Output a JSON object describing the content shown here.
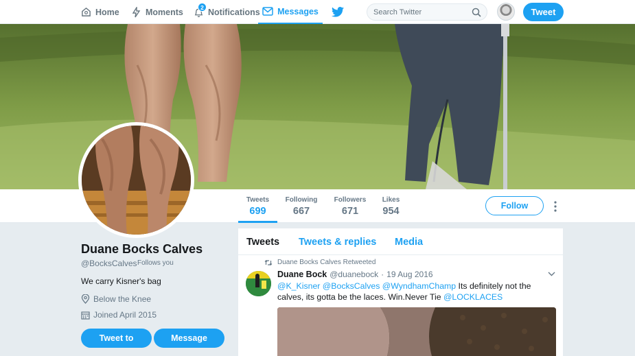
{
  "nav": {
    "home": "Home",
    "moments": "Moments",
    "notifications": "Notifications",
    "notifications_count": "2",
    "messages": "Messages",
    "search_placeholder": "Search Twitter",
    "tweet_button": "Tweet"
  },
  "stats": [
    {
      "label": "Tweets",
      "value": "699"
    },
    {
      "label": "Following",
      "value": "667"
    },
    {
      "label": "Followers",
      "value": "671"
    },
    {
      "label": "Likes",
      "value": "954"
    }
  ],
  "follow_button": "Follow",
  "profile": {
    "name": "Duane Bocks Calves",
    "handle": "@BocksCalves",
    "follows_you": "Follows you",
    "bio": "We carry Kisner's bag",
    "location": "Below the Knee",
    "joined": "Joined April 2015",
    "tweet_to": "Tweet to",
    "message": "Message"
  },
  "tabs": [
    "Tweets",
    "Tweets & replies",
    "Media"
  ],
  "tweet": {
    "retweeted_by": "Duane Bocks Calves Retweeted",
    "author_name": "Duane Bock",
    "author_handle": "@duanebock",
    "separator": "·",
    "date": "19 Aug 2016",
    "mentions": "@K_Kisner @BocksCalves @WyndhamChamp",
    "text": " Its definitely not the calves, its gotta be the laces. Win.Never Tie ",
    "hashtag_link": "@LOCKLACES"
  },
  "colors": {
    "accent": "#1da1f2",
    "background": "#e6ecf0",
    "muted_text": "#657786"
  }
}
